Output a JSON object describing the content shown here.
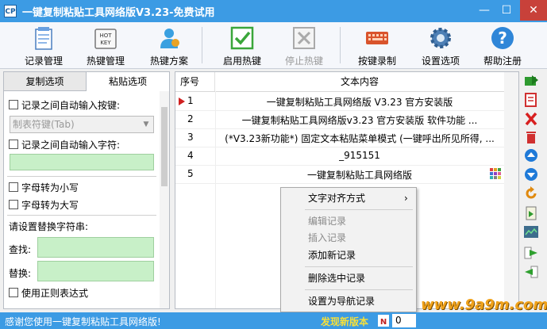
{
  "window": {
    "icon_text": "CP",
    "title": "一键复制粘贴工具网络版V3.23-免费试用",
    "minimize": "—",
    "maximize": "☐",
    "close": "✕"
  },
  "toolbar": {
    "record_manage": "记录管理",
    "hotkey_manage": "热键管理",
    "hotkey_scheme": "热键方案",
    "enable_hotkey": "启用热键",
    "stop_hotkey": "停止热键",
    "hotkey_record": "按键录制",
    "settings": "设置选项",
    "help_register": "帮助注册",
    "hotkey_icon_text_line1": "HOT",
    "hotkey_icon_text_line2": "KEY"
  },
  "left_panel": {
    "tabs": [
      "复制选项",
      "粘贴选项"
    ],
    "active_tab": "粘贴选项",
    "auto_key_label": "记录之间自动输入按键:",
    "key_combo_value": "制表符键(Tab)",
    "auto_char_label": "记录之间自动输入字符:",
    "auto_char_value": "",
    "to_lower": "字母转为小写",
    "to_upper": "字母转为大写",
    "replace_heading": "请设置替换字符串:",
    "find_label": "查找:",
    "replace_label": "替换:",
    "regex_label": "使用正则表达式"
  },
  "list": {
    "headers": {
      "no": "序号",
      "content": "文本内容"
    },
    "rows": [
      {
        "no": "1",
        "text": "一键复制粘贴工具网络版 V3.23 官方安装版",
        "selected": true
      },
      {
        "no": "2",
        "text": "一键复制粘贴工具网络版v3.23 官方安装版      软件功能    ..."
      },
      {
        "no": "3",
        "text": "(*V3.23新功能*) 固定文本粘贴菜单模式 (一键呼出所见所得, ..."
      },
      {
        "no": "4",
        "text": "_915151"
      },
      {
        "no": "5",
        "text": "一键复制粘贴工具网络版"
      }
    ]
  },
  "context_menu": {
    "items": [
      {
        "label": "文字对齐方式",
        "submenu": true,
        "submenu_arrow": "›",
        "enabled": true
      },
      {
        "label": "编辑记录",
        "enabled": false
      },
      {
        "label": "插入记录",
        "enabled": false
      },
      {
        "label": "添加新记录",
        "enabled": true
      },
      {
        "label": "删除选中记录",
        "enabled": true
      },
      {
        "label": "设置为导航记录",
        "enabled": true
      }
    ]
  },
  "status_bar": {
    "message": "感谢您使用一键复制粘贴工具网络版!",
    "new_version": "发现新版本",
    "count": "0"
  },
  "watermark": "www.9a9m.com",
  "colors": {
    "title_bar": "#3c9be4",
    "field_green": "#c8f0c8",
    "status_new": "#f6e03a"
  }
}
